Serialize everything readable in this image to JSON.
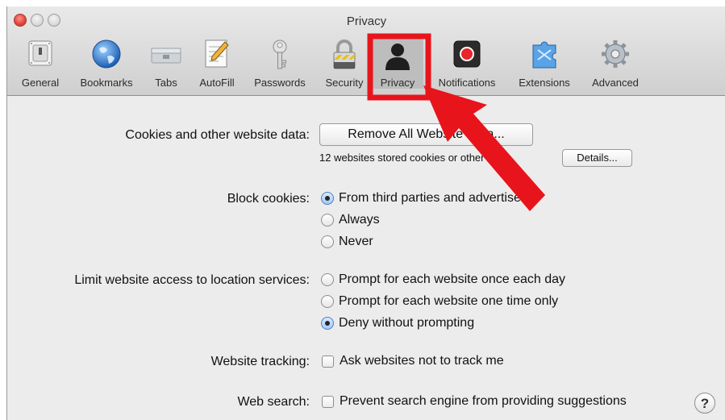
{
  "window": {
    "title": "Privacy"
  },
  "toolbar": {
    "items": [
      {
        "label": "General",
        "icon": "general-switch-icon"
      },
      {
        "label": "Bookmarks",
        "icon": "globe-icon"
      },
      {
        "label": "Tabs",
        "icon": "tabs-icon"
      },
      {
        "label": "AutoFill",
        "icon": "pencil-form-icon"
      },
      {
        "label": "Passwords",
        "icon": "key-icon"
      },
      {
        "label": "Security",
        "icon": "lock-icon"
      },
      {
        "label": "Privacy",
        "icon": "silhouette-icon",
        "selected": true
      },
      {
        "label": "Notifications",
        "icon": "notification-badge-icon"
      },
      {
        "label": "Extensions",
        "icon": "puzzle-icon"
      },
      {
        "label": "Advanced",
        "icon": "gear-icon"
      }
    ]
  },
  "cookies": {
    "label": "Cookies and other website data:",
    "button": "Remove All Website Data...",
    "stored_text": "12 websites stored cookies or other data",
    "details_button": "Details..."
  },
  "block_cookies": {
    "label": "Block cookies:",
    "options": [
      "From third parties and advertisers",
      "Always",
      "Never"
    ],
    "selected": "From third parties and advertisers"
  },
  "location": {
    "label": "Limit website access to location services:",
    "options": [
      "Prompt for each website once each day",
      "Prompt for each website one time only",
      "Deny without prompting"
    ],
    "selected": "Deny without prompting"
  },
  "tracking": {
    "label": "Website tracking:",
    "option": "Ask websites not to track me",
    "checked": false
  },
  "web_search": {
    "label": "Web search:",
    "option": "Prevent search engine from providing suggestions",
    "checked": false,
    "help": "?"
  },
  "annotation": {
    "color": "#e8141b"
  }
}
